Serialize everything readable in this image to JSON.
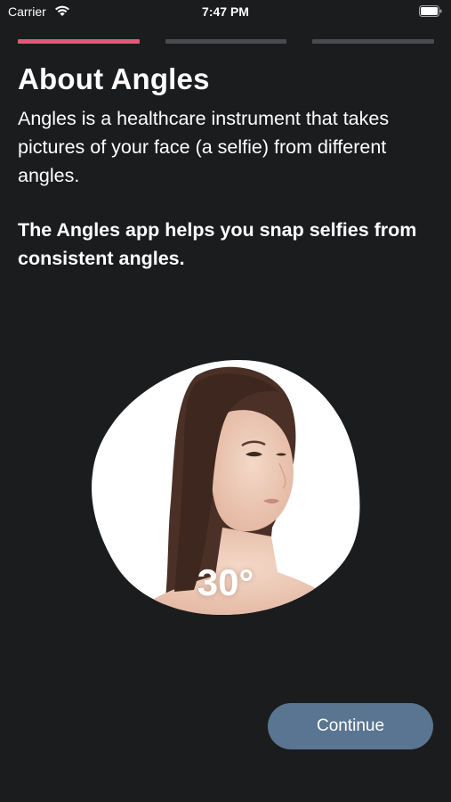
{
  "status_bar": {
    "carrier": "Carrier",
    "time": "7:47 PM"
  },
  "progress": {
    "total_steps": 3,
    "current_step": 1,
    "active_color": "#e8557a",
    "inactive_color": "#4a4b4e"
  },
  "content": {
    "title": "About Angles",
    "intro": "Angles is a healthcare instrument that takes pictures of your face (a selfie) from different angles.",
    "highlight": "The Angles app helps you snap selfies from consistent angles."
  },
  "illustration": {
    "angle_label": "30°"
  },
  "actions": {
    "continue_label": "Continue",
    "button_color": "#5a7591"
  },
  "colors": {
    "background": "#1b1c1e"
  }
}
